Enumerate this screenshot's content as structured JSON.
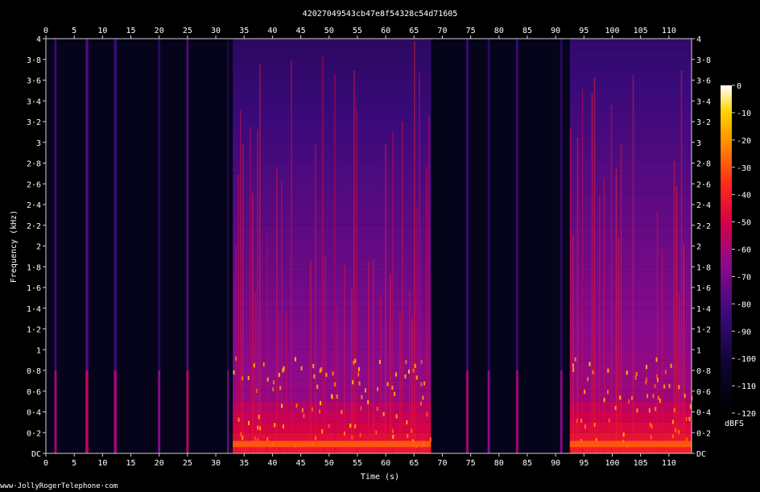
{
  "chart_data": {
    "type": "heatmap",
    "title": "42027049543cb47e8f54328c54d71605",
    "xlabel": "Time (s)",
    "ylabel": "Frequency (kHz)",
    "xlim": [
      0,
      114
    ],
    "ylim": [
      0,
      4
    ],
    "x_ticks": [
      "0",
      "5",
      "10",
      "15",
      "20",
      "25",
      "30",
      "35",
      "40",
      "45",
      "50",
      "55",
      "60",
      "65",
      "70",
      "75",
      "80",
      "85",
      "90",
      "95",
      "100",
      "105",
      "110"
    ],
    "y_ticks": [
      "DC",
      "0·2",
      "0·4",
      "0·6",
      "0·8",
      "1",
      "1·2",
      "1·4",
      "1·6",
      "1·8",
      "2",
      "2·2",
      "2·4",
      "2·6",
      "2·8",
      "3",
      "3·2",
      "3·4",
      "3·6",
      "3·8",
      "4"
    ],
    "colorbar": {
      "label": "dBFS",
      "ticks": [
        "0",
        "-10",
        "-20",
        "-30",
        "-40",
        "-50",
        "-60",
        "-70",
        "-80",
        "-90",
        "-100",
        "-110",
        "-120"
      ],
      "range": [
        -120,
        0
      ]
    },
    "events": [
      {
        "t": 1.5,
        "duration": 0.4,
        "level": -65
      },
      {
        "t": 7.0,
        "duration": 0.5,
        "level": -60
      },
      {
        "t": 12.0,
        "duration": 0.5,
        "level": -65
      },
      {
        "t": 19.8,
        "duration": 0.4,
        "level": -70
      },
      {
        "t": 24.8,
        "duration": 0.4,
        "level": -60
      },
      {
        "t": 32.0,
        "duration": 0.3,
        "level": -75
      },
      {
        "t": 74.2,
        "duration": 0.4,
        "level": -65
      },
      {
        "t": 78.0,
        "duration": 0.4,
        "level": -70
      },
      {
        "t": 83.0,
        "duration": 0.4,
        "level": -65
      },
      {
        "t": 90.8,
        "duration": 0.4,
        "level": -70
      }
    ],
    "dense_regions": [
      {
        "start": 33.0,
        "end": 68.0,
        "level": -60
      },
      {
        "start": 92.5,
        "end": 114.0,
        "level": -58
      }
    ]
  },
  "footer": {
    "text": "www·JollyRogerTelephone·com"
  }
}
